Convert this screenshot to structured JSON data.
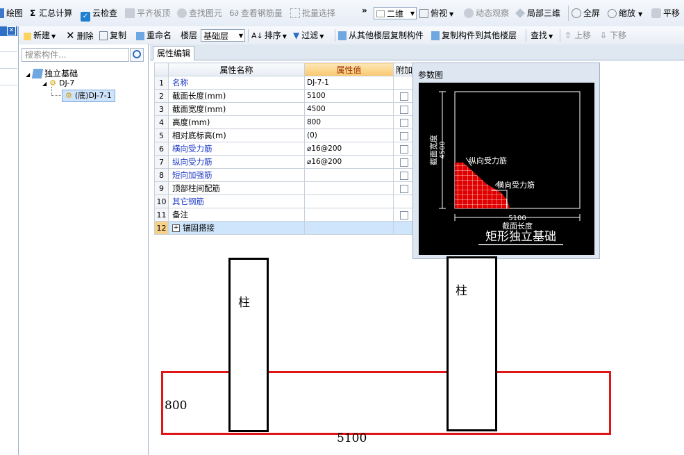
{
  "toolbar_main": {
    "draw": "绘图",
    "summary": "汇总计算",
    "cloud_check": "云检查",
    "align_top": "平齐板顶",
    "find_element": "查找图元",
    "view_rebar": "查看钢筋量",
    "batch_select": "批量选择",
    "more": "»",
    "view_mode": "二维",
    "top_view": "俯视",
    "dynamic_view": "动态观察",
    "local_3d": "局部三维",
    "fullscreen": "全屏",
    "zoom": "缩放",
    "pan": "平移"
  },
  "toolbar_edit": {
    "new": "新建",
    "delete": "删除",
    "copy": "复制",
    "rename": "重命名",
    "floor_label": "楼层",
    "floor_value": "基础层",
    "sort": "排序",
    "filter": "过滤",
    "copy_from_other": "从其他楼层复制构件",
    "copy_to_other": "复制构件到其他楼层",
    "find": "查找",
    "move_up": "上移",
    "move_down": "下移"
  },
  "tree": {
    "search_placeholder": "搜索构件...",
    "root": "独立基础",
    "child": "DJ-7",
    "leaf": "(底)DJ-7-1"
  },
  "props": {
    "tab": "属性编辑",
    "headers": [
      "属性名称",
      "属性值",
      "附加"
    ],
    "rows": [
      {
        "num": "1",
        "name": "名称",
        "value": "DJ-7-1",
        "blue": true,
        "check": false
      },
      {
        "num": "2",
        "name": "截面长度(mm)",
        "value": "5100",
        "blue": false,
        "check": true
      },
      {
        "num": "3",
        "name": "截面宽度(mm)",
        "value": "4500",
        "blue": false,
        "check": true
      },
      {
        "num": "4",
        "name": "高度(mm)",
        "value": "800",
        "blue": false,
        "check": true
      },
      {
        "num": "5",
        "name": "相对底标高(m)",
        "value": "(0)",
        "blue": false,
        "check": true
      },
      {
        "num": "6",
        "name": "横向受力筋",
        "value": "⌀16@200",
        "blue": true,
        "check": true
      },
      {
        "num": "7",
        "name": "纵向受力筋",
        "value": "⌀16@200",
        "blue": true,
        "check": true
      },
      {
        "num": "8",
        "name": "短向加强筋",
        "value": "",
        "blue": true,
        "check": true
      },
      {
        "num": "9",
        "name": "顶部柱间配筋",
        "value": "",
        "blue": false,
        "check": true
      },
      {
        "num": "10",
        "name": "其它钢筋",
        "value": "",
        "blue": true,
        "check": false
      },
      {
        "num": "11",
        "name": "备注",
        "value": "",
        "blue": false,
        "check": true
      },
      {
        "num": "12",
        "name": "锚固搭接",
        "value": "",
        "blue": false,
        "check": false,
        "expand": true,
        "selected": true
      }
    ]
  },
  "param_diagram": {
    "title": "参数图",
    "width_label": "截面宽度",
    "width_value": "4500",
    "length_value": "5100",
    "length_label": "截面长度",
    "long_rebar": "纵向受力筋",
    "trans_rebar": "横向受力筋",
    "caption": "矩形独立基础"
  },
  "sketch": {
    "column_label": "柱",
    "height_label": "800",
    "length_label": "5100"
  },
  "colors": {
    "accent_header": "#f9c86e",
    "link_blue": "#1d39c4",
    "sketch_red": "#e01515"
  }
}
